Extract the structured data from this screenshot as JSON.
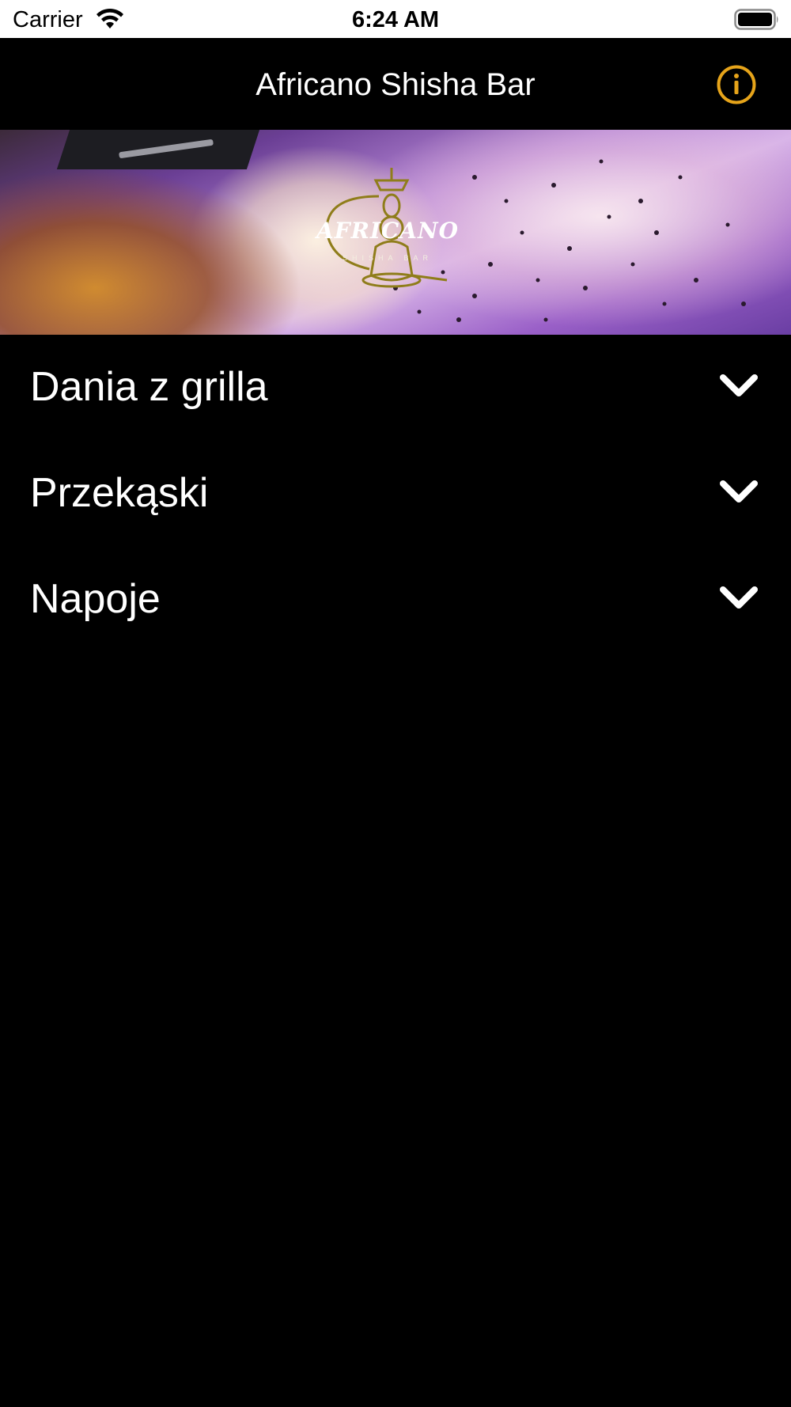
{
  "status_bar": {
    "carrier": "Carrier",
    "time": "6:24 AM",
    "icons": [
      "wifi-icon",
      "battery-icon"
    ]
  },
  "nav": {
    "title": "Africano Shisha Bar",
    "info_icon": "info-icon",
    "accent_color": "#E6A41A"
  },
  "banner": {
    "logo_text": "AFRICANO",
    "logo_sub": "SHISHA BAR"
  },
  "menu": {
    "items": [
      {
        "label": "Dania z grilla",
        "icon": "chevron-down-icon"
      },
      {
        "label": "Przekąski",
        "icon": "chevron-down-icon"
      },
      {
        "label": "Napoje",
        "icon": "chevron-down-icon"
      }
    ]
  },
  "colors": {
    "background": "#000000",
    "text": "#FFFFFF",
    "status_bar": "#FFFFFF"
  }
}
